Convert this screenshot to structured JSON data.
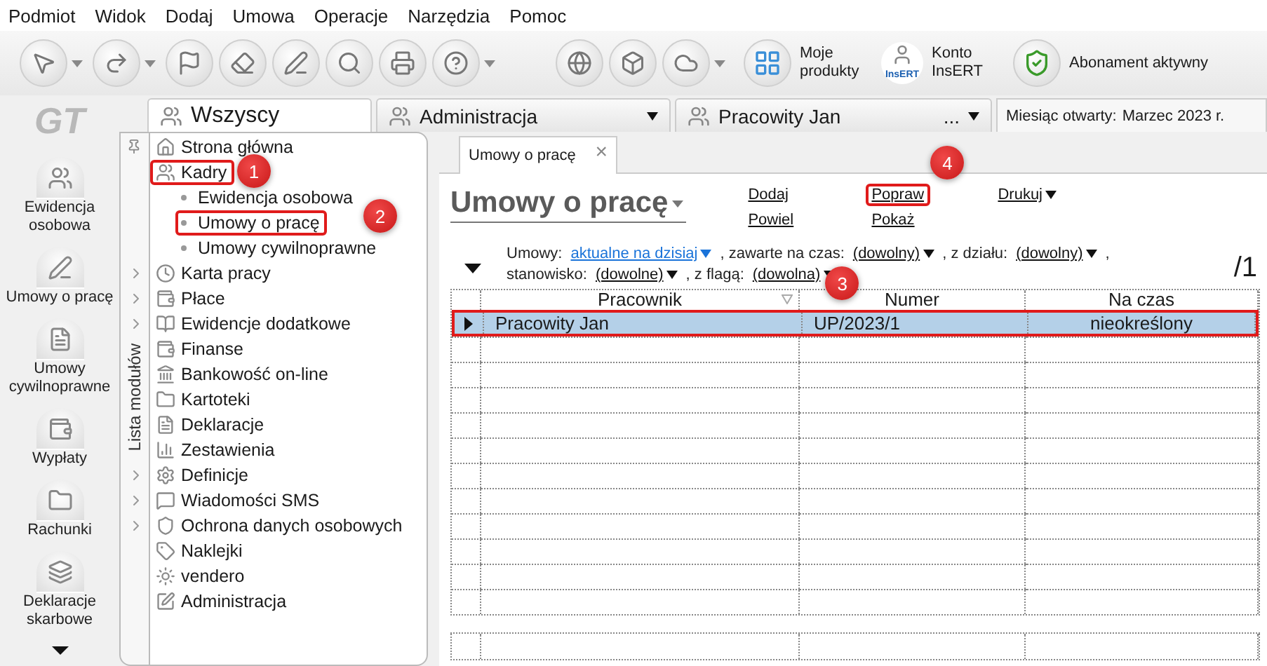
{
  "menu": [
    "Podmiot",
    "Widok",
    "Dodaj",
    "Umowa",
    "Operacje",
    "Narzędzia",
    "Pomoc"
  ],
  "toolbar": {
    "icon_buttons": [
      {
        "dropdown": true
      },
      {
        "dropdown": true
      },
      {
        "dropdown": false
      },
      {
        "dropdown": false
      },
      {
        "dropdown": false
      },
      {
        "dropdown": false
      },
      {
        "dropdown": false
      },
      {
        "dropdown": true
      }
    ],
    "service_buttons": [
      {
        "dropdown": false
      },
      {
        "dropdown": false
      },
      {
        "dropdown": true
      }
    ],
    "labeled_buttons": [
      "Moje produkty",
      "Konto InsERT",
      "Abonament aktywny"
    ],
    "badge": "InsERT"
  },
  "logo": "GT",
  "tabs": [
    {
      "label": "Wszyscy",
      "selected": true,
      "dropdown": false
    },
    {
      "label": "Administracja",
      "selected": false,
      "dropdown": true
    },
    {
      "label": "Pracowity Jan",
      "selected": false,
      "dropdown": true,
      "more": "..."
    }
  ],
  "month": {
    "label": "Miesiąc otwarty:",
    "value": "Marzec 2023 r."
  },
  "left_nav": [
    "Ewidencja osobowa",
    "Umowy o pracę",
    "Umowy cywilnoprawne",
    "Wypłaty",
    "Rachunki",
    "Deklaracje skarbowe"
  ],
  "modules": {
    "title": "Lista modułów",
    "items": [
      {
        "label": "Strona główna",
        "expandable": false,
        "highlighted": false
      },
      {
        "label": "Kadry",
        "expandable": false,
        "highlighted": true,
        "callout": "1",
        "children": [
          {
            "label": "Ewidencja osobowa",
            "highlighted": false
          },
          {
            "label": "Umowy o pracę",
            "highlighted": true,
            "callout": "2"
          },
          {
            "label": "Umowy cywilnoprawne",
            "highlighted": false
          }
        ]
      },
      {
        "label": "Karta pracy",
        "expandable": true,
        "highlighted": false
      },
      {
        "label": "Płace",
        "expandable": true,
        "highlighted": false
      },
      {
        "label": "Ewidencje dodatkowe",
        "expandable": true,
        "highlighted": false
      },
      {
        "label": "Finanse",
        "expandable": false,
        "highlighted": false
      },
      {
        "label": "Bankowość on-line",
        "expandable": false,
        "highlighted": false
      },
      {
        "label": "Kartoteki",
        "expandable": false,
        "highlighted": false
      },
      {
        "label": "Deklaracje",
        "expandable": false,
        "highlighted": false
      },
      {
        "label": "Zestawienia",
        "expandable": false,
        "highlighted": false
      },
      {
        "label": "Definicje",
        "expandable": true,
        "highlighted": false
      },
      {
        "label": "Wiadomości SMS",
        "expandable": true,
        "highlighted": false
      },
      {
        "label": "Ochrona danych osobowych",
        "expandable": true,
        "highlighted": false
      },
      {
        "label": "Naklejki",
        "expandable": false,
        "highlighted": false
      },
      {
        "label": "vendero",
        "expandable": false,
        "highlighted": false
      },
      {
        "label": "Administracja",
        "expandable": false,
        "highlighted": false
      }
    ]
  },
  "document_tab": {
    "label": "Umowy o pracę",
    "close": "×"
  },
  "page_title": "Umowy o pracę",
  "actions": [
    {
      "label": "Dodaj",
      "dropdown": false,
      "highlighted": false
    },
    {
      "label": "Powiel",
      "dropdown": false,
      "highlighted": false
    },
    {
      "label": "Popraw",
      "dropdown": false,
      "highlighted": true,
      "callout": "4"
    },
    {
      "label": "Pokaż",
      "dropdown": false,
      "highlighted": false
    },
    {
      "label": "Drukuj",
      "dropdown": true,
      "highlighted": false
    }
  ],
  "filter_lines": [
    [
      {
        "label": "Umowy:",
        "value": "aktualne na dzisiaj",
        "kind": "link"
      },
      {
        "label": ", zawarte na czas:",
        "value": "(dowolny)",
        "kind": "plain"
      },
      {
        "label": ", z działu:",
        "value": "(dowolny)",
        "kind": "plain"
      },
      {
        "label": ",",
        "kind": "text"
      }
    ],
    [
      {
        "label": "stanowisko:",
        "value": "(dowolne)",
        "kind": "plain"
      },
      {
        "label": ", z flagą:",
        "value": "(dowolna)",
        "kind": "plain",
        "callout": "3"
      }
    ]
  ],
  "count": "/1",
  "table": {
    "columns": [
      {
        "label": "Pracownik",
        "sortable": true
      },
      {
        "label": "Numer",
        "sortable": false
      },
      {
        "label": "Na czas",
        "sortable": false
      }
    ],
    "rows": [
      {
        "selected": true,
        "highlighted": true,
        "cells": [
          "Pracowity Jan",
          "UP/2023/1",
          "nieokreślony"
        ]
      }
    ]
  }
}
